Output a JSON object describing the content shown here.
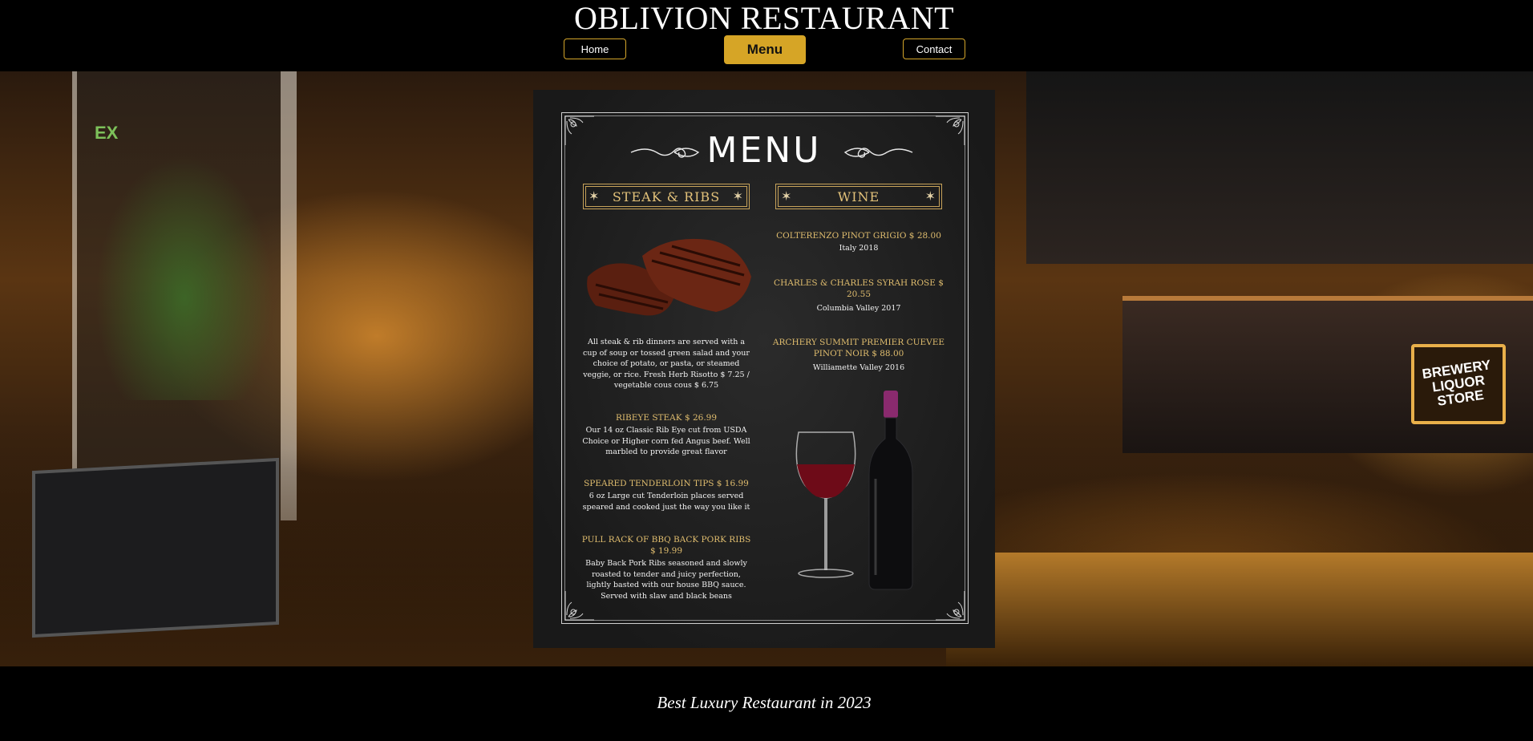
{
  "header": {
    "title": "OBLIVION RESTAURANT",
    "nav": {
      "home": "Home",
      "menu": "Menu",
      "contact": "Contact"
    }
  },
  "hero": {
    "store_sign": "BREWERY\nLIQUOR\nSTORE",
    "exit_sign": "EX"
  },
  "menu": {
    "heading": "MENU",
    "steak_section": {
      "title": "STEAK & RIBS",
      "intro": "All steak & rib dinners are served with a cup of soup or tossed green salad and your choice of potato, or pasta, or steamed veggie, or rice. Fresh Herb Risotto $ 7.25 / vegetable cous cous $ 6.75",
      "items": [
        {
          "name": "RIBEYE STEAK $ 26.99",
          "desc": "Our 14 oz Classic Rib Eye cut from USDA Choice or Higher corn fed Angus beef. Well marbled to provide great flavor"
        },
        {
          "name": "SPEARED TENDERLOIN TIPS   $ 16.99",
          "desc": "6 oz Large cut Tenderloin places served speared and cooked just the way you like it"
        },
        {
          "name": "PULL RACK OF BBQ BACK PORK RIBS $ 19.99",
          "desc": "Baby Back Pork Ribs seasoned and slowly roasted to tender and juicy perfection, lightly basted with our house BBQ sauce. Served with slaw and black beans"
        }
      ]
    },
    "wine_section": {
      "title": "WINE",
      "items": [
        {
          "name": "COLTERENZO PINOT GRIGIO   $ 28.00",
          "origin": "Italy 2018"
        },
        {
          "name": "CHARLES & CHARLES SYRAH ROSE $ 20.55",
          "origin": "Columbia Valley 2017"
        },
        {
          "name": "ARCHERY SUMMIT PREMIER CUEVEE PINOT NOIR   $ 88.00",
          "origin": "Williamette Valley 2016"
        }
      ]
    }
  },
  "footer": {
    "tagline": "Best Luxury Restaurant in 2023"
  },
  "colors": {
    "accent": "#d6a526",
    "menu_gold": "#e0bd6e",
    "wine": "#7a0f1a"
  }
}
